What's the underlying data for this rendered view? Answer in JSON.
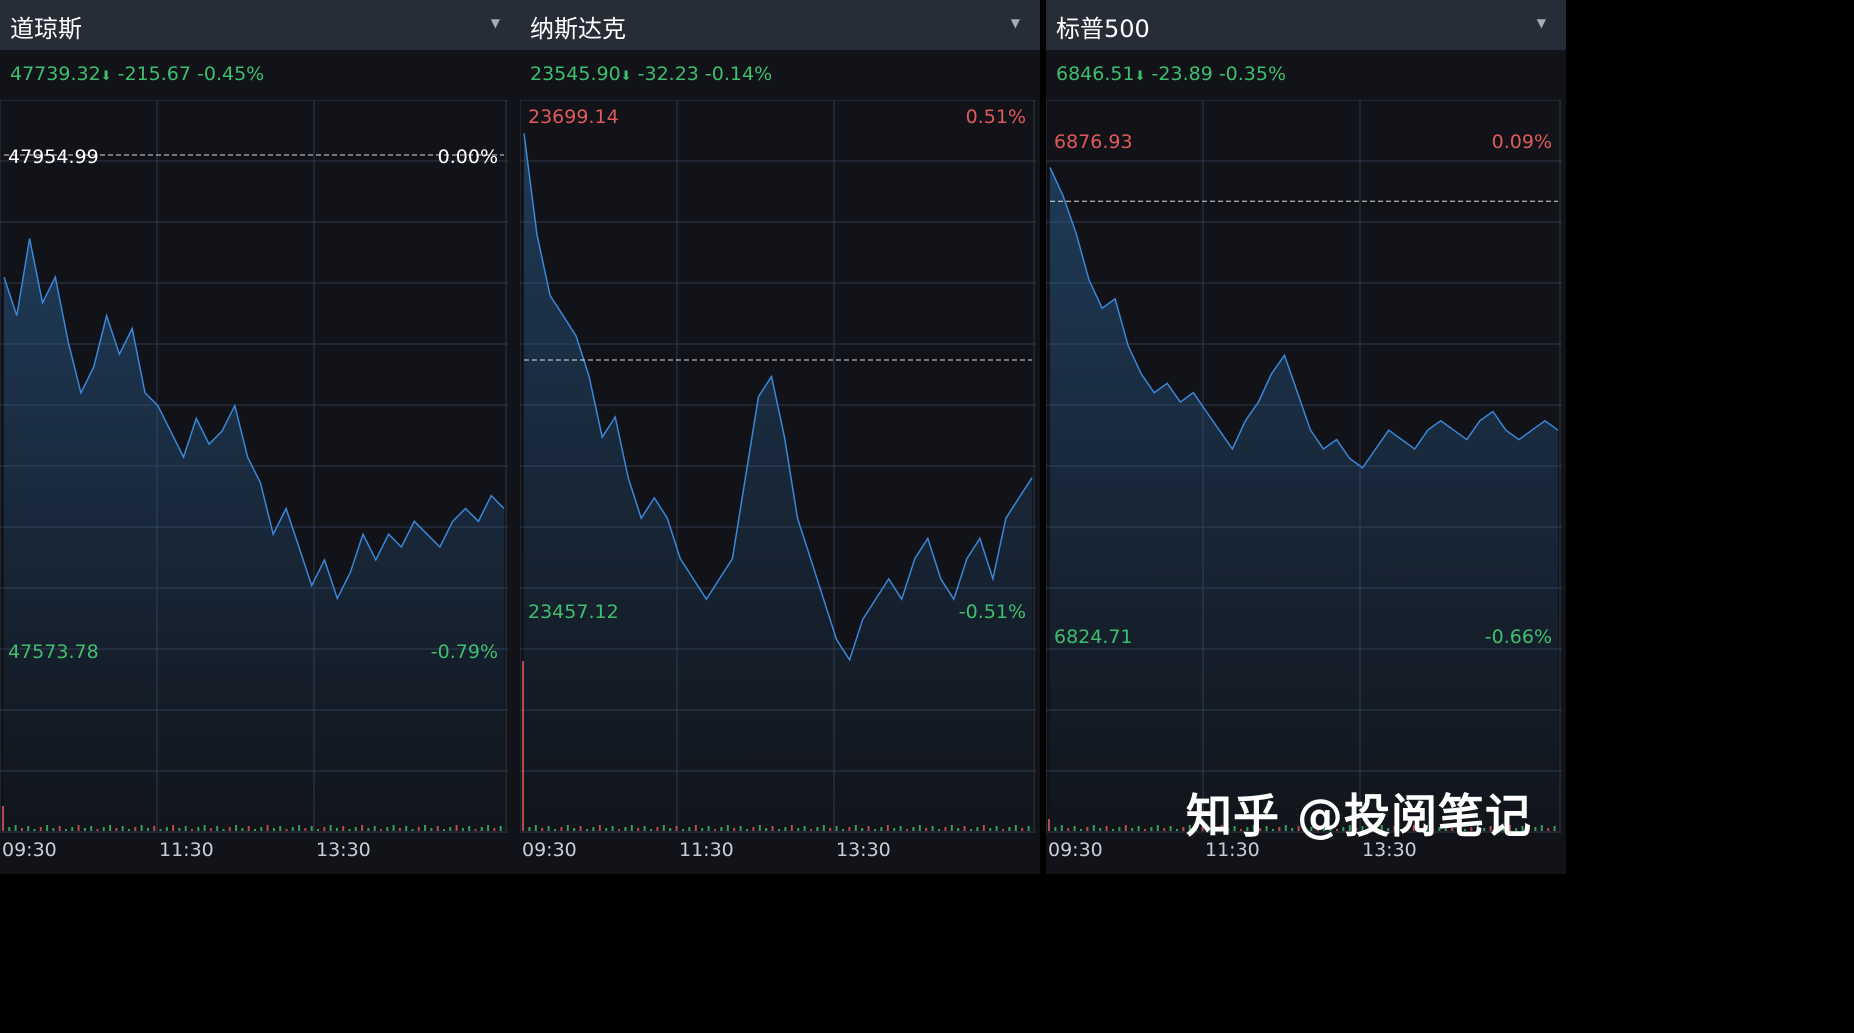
{
  "colors": {
    "up": "#e05a5a",
    "down": "#3dbf6e",
    "line": "#3a86d8",
    "grid": "#2f3a4a",
    "ref": "#ffffff"
  },
  "panels": [
    {
      "title": "道琼斯",
      "price": "47739.32",
      "arrow": "⬇",
      "change": "-215.67",
      "pct": "-0.45%",
      "high_label": "47954.99",
      "high_pct": "0.00%",
      "low_label": "47573.78",
      "low_pct": "-0.79%"
    },
    {
      "title": "纳斯达克",
      "price": "23545.90",
      "arrow": "⬇",
      "change": "-32.23",
      "pct": "-0.14%",
      "high_label": "23699.14",
      "high_pct": "0.51%",
      "low_label": "23457.12",
      "low_pct": "-0.51%"
    },
    {
      "title": "标普500",
      "price": "6846.51",
      "arrow": "⬇",
      "change": "-23.89",
      "pct": "-0.35%",
      "high_label": "6876.93",
      "high_pct": "0.09%",
      "low_label": "6824.71",
      "low_pct": "-0.66%"
    }
  ],
  "watermark": "知乎 @投阅笔记",
  "chart_data": [
    {
      "type": "line",
      "title": "道琼斯",
      "x_ticks": [
        "09:30",
        "11:30",
        "13:30"
      ],
      "prev_close": 47954.99,
      "ylim": [
        47573.78,
        47954.99
      ],
      "x": [
        0,
        10,
        20,
        30,
        40,
        50,
        60,
        70,
        80,
        90,
        100,
        110,
        120,
        130,
        140,
        150,
        160,
        170,
        180,
        190,
        200,
        210,
        220,
        230,
        240,
        250,
        260,
        270,
        280,
        290,
        300,
        310,
        320,
        330,
        340,
        350,
        360,
        370,
        380,
        390
      ],
      "values": [
        47860,
        47830,
        47890,
        47840,
        47860,
        47810,
        47770,
        47790,
        47830,
        47800,
        47820,
        47770,
        47760,
        47740,
        47720,
        47750,
        47730,
        47740,
        47760,
        47720,
        47700,
        47660,
        47680,
        47650,
        47620,
        47640,
        47610,
        47630,
        47660,
        47640,
        47660,
        47650,
        47670,
        47660,
        47650,
        47670,
        47680,
        47670,
        47690,
        47680
      ]
    },
    {
      "type": "line",
      "title": "纳斯达克",
      "x_ticks": [
        "09:30",
        "11:30",
        "13:30"
      ],
      "prev_close": 23578.13,
      "ylim": [
        23457.12,
        23699.14
      ],
      "x": [
        0,
        10,
        20,
        30,
        40,
        50,
        60,
        70,
        80,
        90,
        100,
        110,
        120,
        130,
        140,
        150,
        160,
        170,
        180,
        190,
        200,
        210,
        220,
        230,
        240,
        250,
        260,
        270,
        280,
        290,
        300,
        310,
        320,
        330,
        340,
        350,
        360,
        370,
        380,
        390
      ],
      "values": [
        23690,
        23640,
        23610,
        23600,
        23590,
        23570,
        23540,
        23550,
        23520,
        23500,
        23510,
        23500,
        23480,
        23470,
        23460,
        23470,
        23480,
        23520,
        23560,
        23570,
        23540,
        23500,
        23480,
        23460,
        23440,
        23430,
        23450,
        23460,
        23470,
        23460,
        23480,
        23490,
        23470,
        23460,
        23480,
        23490,
        23470,
        23500,
        23510,
        23520
      ]
    },
    {
      "type": "line",
      "title": "标普500",
      "x_ticks": [
        "09:30",
        "11:30",
        "13:30"
      ],
      "prev_close": 6870.4,
      "ylim": [
        6824.71,
        6876.93
      ],
      "x": [
        0,
        10,
        20,
        30,
        40,
        50,
        60,
        70,
        80,
        90,
        100,
        110,
        120,
        130,
        140,
        150,
        160,
        170,
        180,
        190,
        200,
        210,
        220,
        230,
        240,
        250,
        260,
        270,
        280,
        290,
        300,
        310,
        320,
        330,
        340,
        350,
        360,
        370,
        380,
        390
      ],
      "values": [
        6874,
        6871,
        6867,
        6862,
        6859,
        6860,
        6855,
        6852,
        6850,
        6851,
        6849,
        6850,
        6848,
        6846,
        6844,
        6847,
        6849,
        6852,
        6854,
        6850,
        6846,
        6844,
        6845,
        6843,
        6842,
        6844,
        6846,
        6845,
        6844,
        6846,
        6847,
        6846,
        6845,
        6847,
        6848,
        6846,
        6845,
        6846,
        6847,
        6846
      ]
    }
  ]
}
